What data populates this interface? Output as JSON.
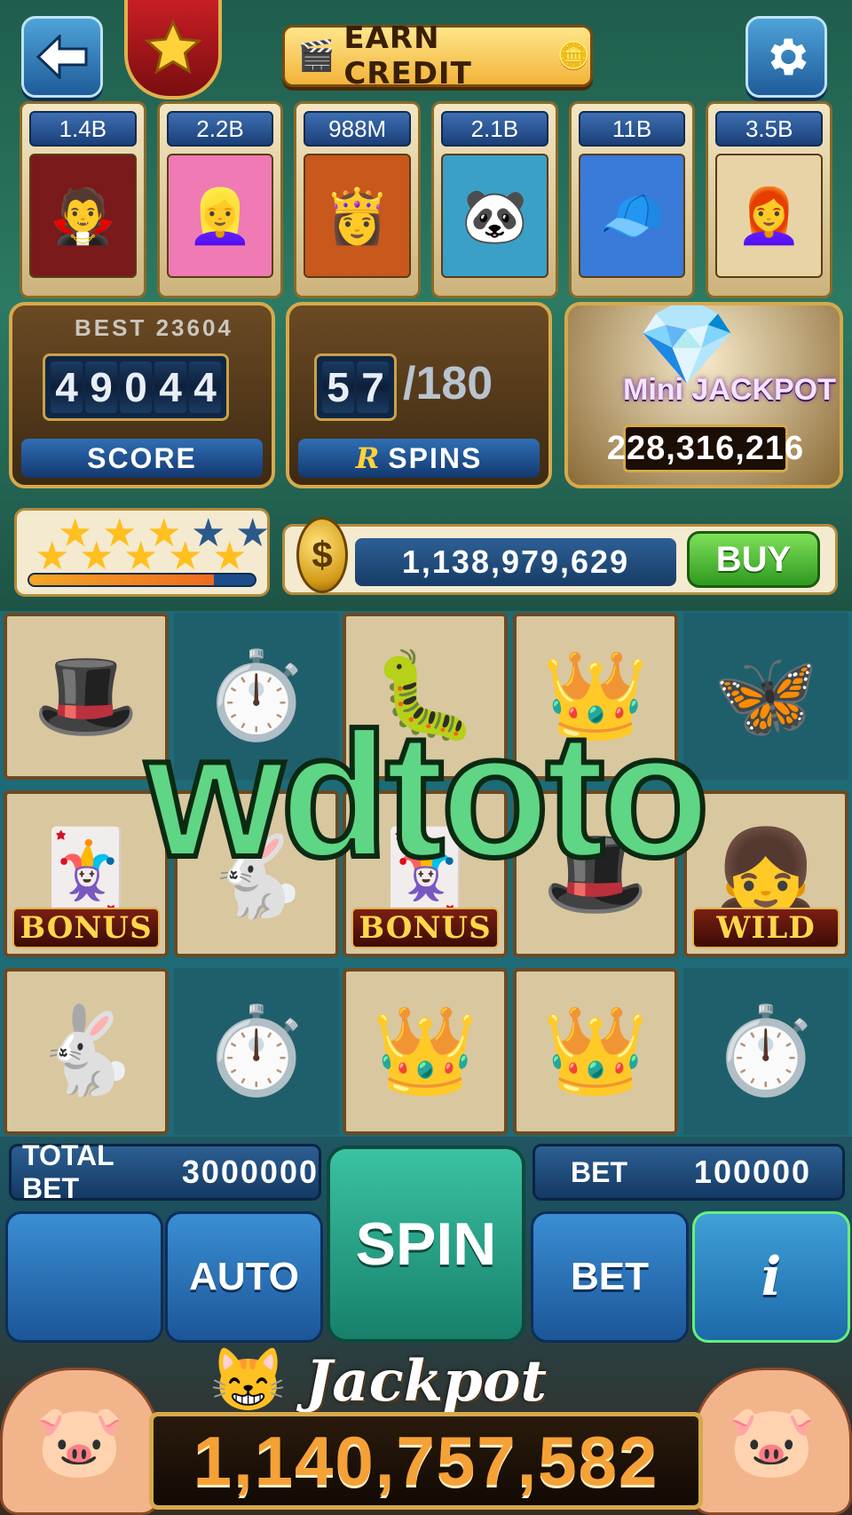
{
  "header": {
    "back_icon": "arrow-left-icon",
    "rank_icon": "star-icon",
    "earn_credit_label": "EARN CREDIT",
    "settings_icon": "gear-icon"
  },
  "leaderboard": [
    {
      "amount": "1.4B",
      "avatar": "🧛"
    },
    {
      "amount": "2.2B",
      "avatar": "👱‍♀️"
    },
    {
      "amount": "988M",
      "avatar": "👸"
    },
    {
      "amount": "2.1B",
      "avatar": "🐼"
    },
    {
      "amount": "11B",
      "avatar": "🧢"
    },
    {
      "amount": "3.5B",
      "avatar": "👩‍🦰"
    }
  ],
  "score": {
    "best_label": "BEST 23604",
    "digits": [
      "4",
      "9",
      "0",
      "4",
      "4"
    ],
    "label": "SCORE"
  },
  "spins": {
    "digits": [
      "5",
      "7"
    ],
    "total": "/180",
    "label": "SPINS",
    "logo": "R"
  },
  "mini_jackpot": {
    "title": "Mini JACKPOT",
    "value": "228,316,216"
  },
  "level": {
    "stars_filled": 8,
    "stars_total": 10,
    "progress": 0.82
  },
  "balance": {
    "coin_symbol": "$",
    "value": "1,138,979,629",
    "buy_label": "BUY"
  },
  "reels": [
    [
      {
        "symbol": "🎩",
        "tag": "",
        "framed": true
      },
      {
        "symbol": "🃏",
        "tag": "BONUS",
        "framed": true
      },
      {
        "symbol": "🐇",
        "tag": "",
        "framed": true
      }
    ],
    [
      {
        "symbol": "⏱️",
        "tag": "",
        "framed": false
      },
      {
        "symbol": "🐇",
        "tag": "",
        "framed": true
      },
      {
        "symbol": "⏱️",
        "tag": "",
        "framed": false
      }
    ],
    [
      {
        "symbol": "🐛",
        "tag": "",
        "framed": true
      },
      {
        "symbol": "🃏",
        "tag": "BONUS",
        "framed": true
      },
      {
        "symbol": "👑",
        "tag": "",
        "framed": true
      }
    ],
    [
      {
        "symbol": "👑",
        "tag": "",
        "framed": true
      },
      {
        "symbol": "🎩",
        "tag": "",
        "framed": true
      },
      {
        "symbol": "👑",
        "tag": "",
        "framed": true
      }
    ],
    [
      {
        "symbol": "🦋",
        "tag": "",
        "framed": false
      },
      {
        "symbol": "👧",
        "tag": "WILD",
        "framed": true
      },
      {
        "symbol": "⏱️",
        "tag": "",
        "framed": false
      }
    ]
  ],
  "watermark": "wdtoto",
  "controls": {
    "total_bet_label": "TOTAL BET",
    "total_bet_value": "3000000",
    "bet_label": "BET",
    "bet_value": "100000",
    "auto_label": "AUTO",
    "spin_label": "SPIN",
    "bet_button_label": "BET",
    "info_label": "i"
  },
  "jackpot": {
    "title": "Jackpot",
    "value": "1,140,757,582"
  }
}
